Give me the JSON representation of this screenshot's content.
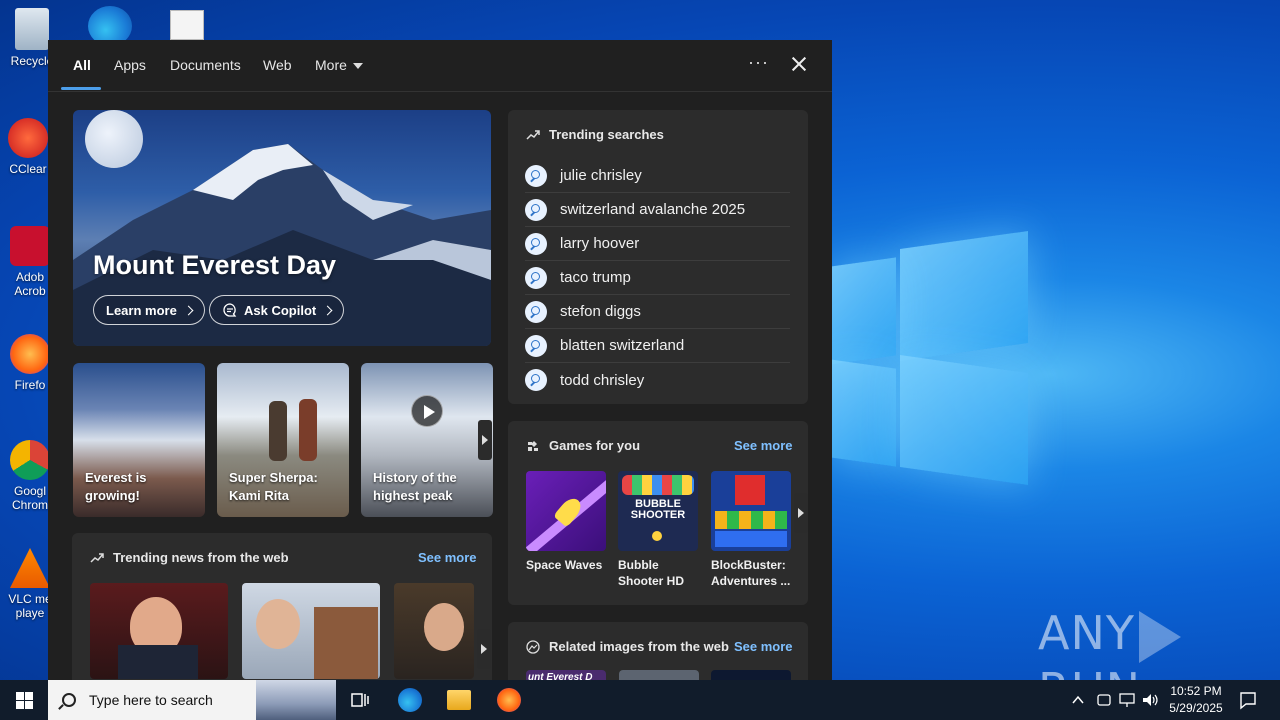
{
  "desktop": {
    "icons": [
      {
        "label": "Recycle"
      },
      {
        "label": "CClear"
      },
      {
        "label": "Adob Acrob"
      },
      {
        "label": "Firefo"
      },
      {
        "label": "Googl Chrom"
      },
      {
        "label": "VLC me playe"
      }
    ],
    "watermark": {
      "left": "ANY",
      "right": "RUN"
    }
  },
  "panel": {
    "tabs": [
      {
        "label": "All"
      },
      {
        "label": "Apps"
      },
      {
        "label": "Documents"
      },
      {
        "label": "Web"
      },
      {
        "label": "More"
      }
    ],
    "hero": {
      "title": "Mount Everest Day",
      "learn_more": "Learn more",
      "ask_copilot": "Ask Copilot"
    },
    "cards": [
      {
        "caption": "Everest is growing!"
      },
      {
        "caption": "Super Sherpa: Kami Rita"
      },
      {
        "caption": "History of the highest peak"
      }
    ],
    "trending": {
      "title": "Trending searches",
      "items": [
        "julie chrisley",
        "switzerland avalanche 2025",
        "larry hoover",
        "taco trump",
        "stefon diggs",
        "blatten switzerland",
        "todd chrisley"
      ]
    },
    "games": {
      "title": "Games for you",
      "see_more": "See more",
      "items": [
        {
          "name": "Space Waves"
        },
        {
          "name": "Bubble Shooter HD"
        },
        {
          "name": "BlockBuster: Adventures ..."
        }
      ],
      "bubble_logo": "BUBBLE SHOOTER"
    },
    "news": {
      "title": "Trending news from the web",
      "see_more": "See more"
    },
    "images": {
      "title": "Related images from the web",
      "see_more": "See more",
      "first_caption": "unt Everest D"
    }
  },
  "taskbar": {
    "search_placeholder": "Type here to search",
    "time": "10:52 PM",
    "date": "5/29/2025"
  },
  "colors": {
    "accent": "#4c9eea",
    "link": "#7fc0ff",
    "panel_bg": "#202020",
    "section_bg": "#2c2c2c"
  }
}
